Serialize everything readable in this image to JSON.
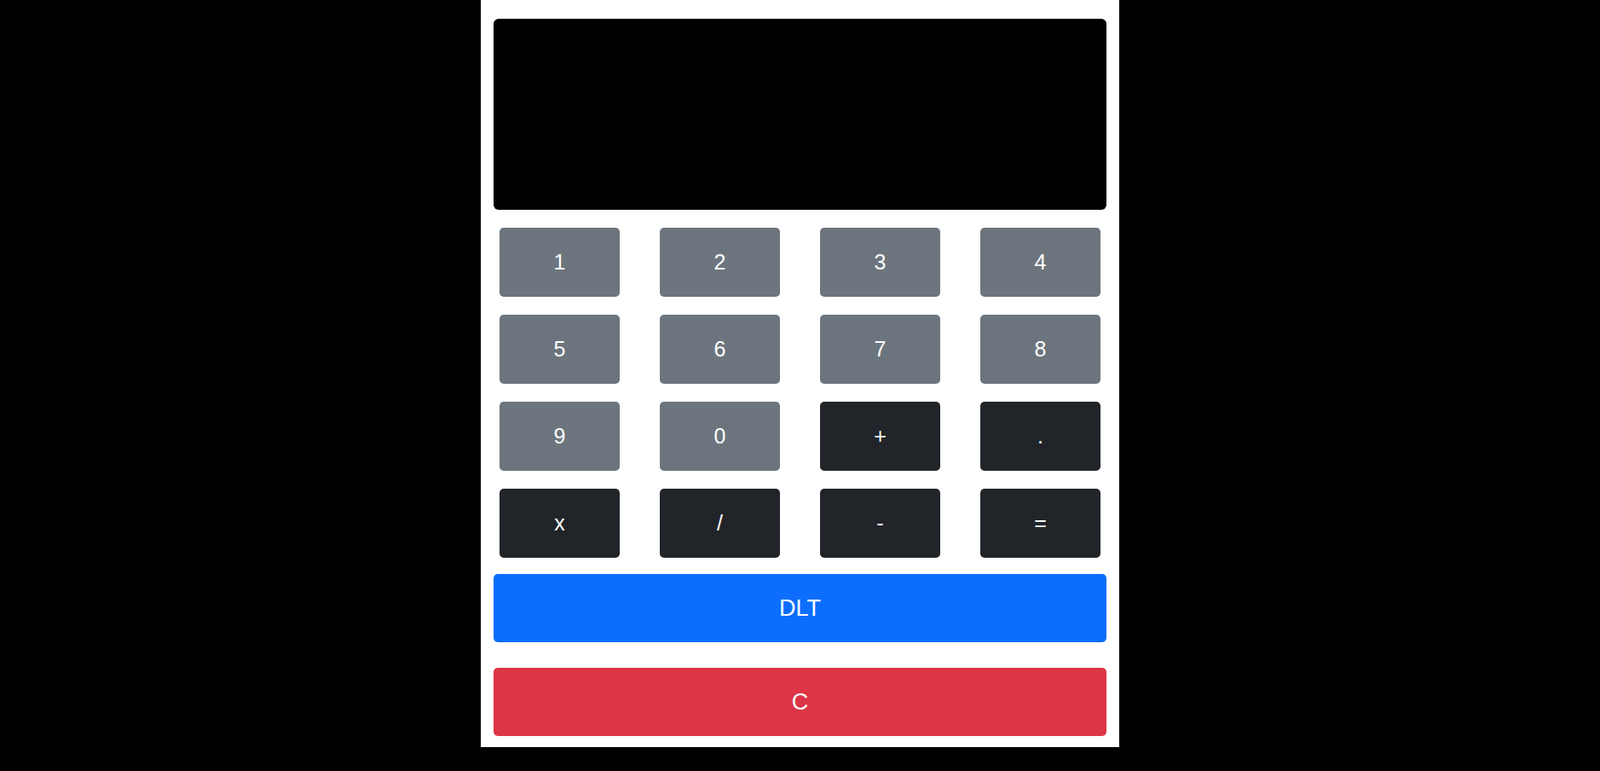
{
  "display": {
    "value": ""
  },
  "keys": [
    {
      "label": "1",
      "kind": "digit"
    },
    {
      "label": "2",
      "kind": "digit"
    },
    {
      "label": "3",
      "kind": "digit"
    },
    {
      "label": "4",
      "kind": "digit"
    },
    {
      "label": "5",
      "kind": "digit"
    },
    {
      "label": "6",
      "kind": "digit"
    },
    {
      "label": "7",
      "kind": "digit"
    },
    {
      "label": "8",
      "kind": "digit"
    },
    {
      "label": "9",
      "kind": "digit"
    },
    {
      "label": "0",
      "kind": "digit"
    },
    {
      "label": "+",
      "kind": "operator"
    },
    {
      "label": ".",
      "kind": "operator"
    },
    {
      "label": "x",
      "kind": "operator"
    },
    {
      "label": "/",
      "kind": "operator"
    },
    {
      "label": "-",
      "kind": "operator"
    },
    {
      "label": "=",
      "kind": "operator"
    }
  ],
  "delete_button": {
    "label": "DLT"
  },
  "clear_button": {
    "label": "C"
  }
}
